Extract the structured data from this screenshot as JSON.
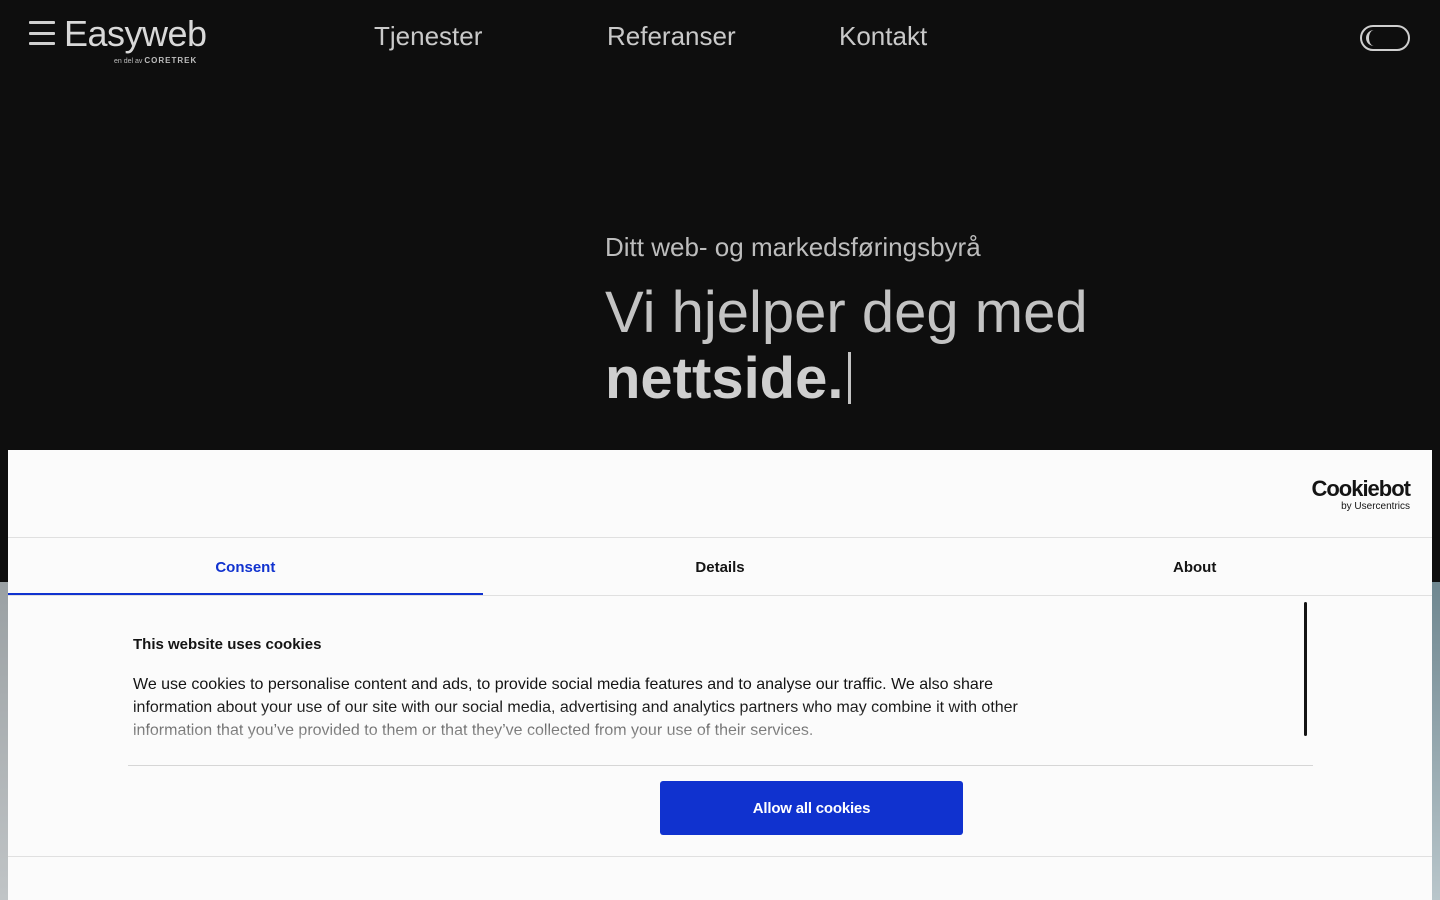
{
  "header": {
    "logo": "Easyweb",
    "logo_sub_prefix": "en del av",
    "logo_sub_brand": "CORETREK",
    "nav": [
      {
        "label": "Tjenester"
      },
      {
        "label": "Referanser"
      },
      {
        "label": "Kontakt"
      }
    ]
  },
  "hero": {
    "subtitle": "Ditt web- og markedsføringsbyrå",
    "title_line1": "Vi hjelper deg med",
    "title_line2": "nettside."
  },
  "cookie_dialog": {
    "brand_name": "Cookiebot",
    "brand_sub": "by Usercentrics",
    "tabs": [
      {
        "label": "Consent",
        "active": true
      },
      {
        "label": "Details",
        "active": false
      },
      {
        "label": "About",
        "active": false
      }
    ],
    "heading": "This website uses cookies",
    "body": "We use cookies to personalise content and ads, to provide social media features and to analyse our traffic. We also share information about your use of our site with our social media, advertising and analytics partners who may combine it with other information that you’ve provided to them or that they’ve collected from your use of their services.",
    "allow_label": "Allow all cookies"
  },
  "colors": {
    "background": "#0e0e0e",
    "accent": "#1032cf",
    "dialog_bg": "#fbfbfb"
  }
}
